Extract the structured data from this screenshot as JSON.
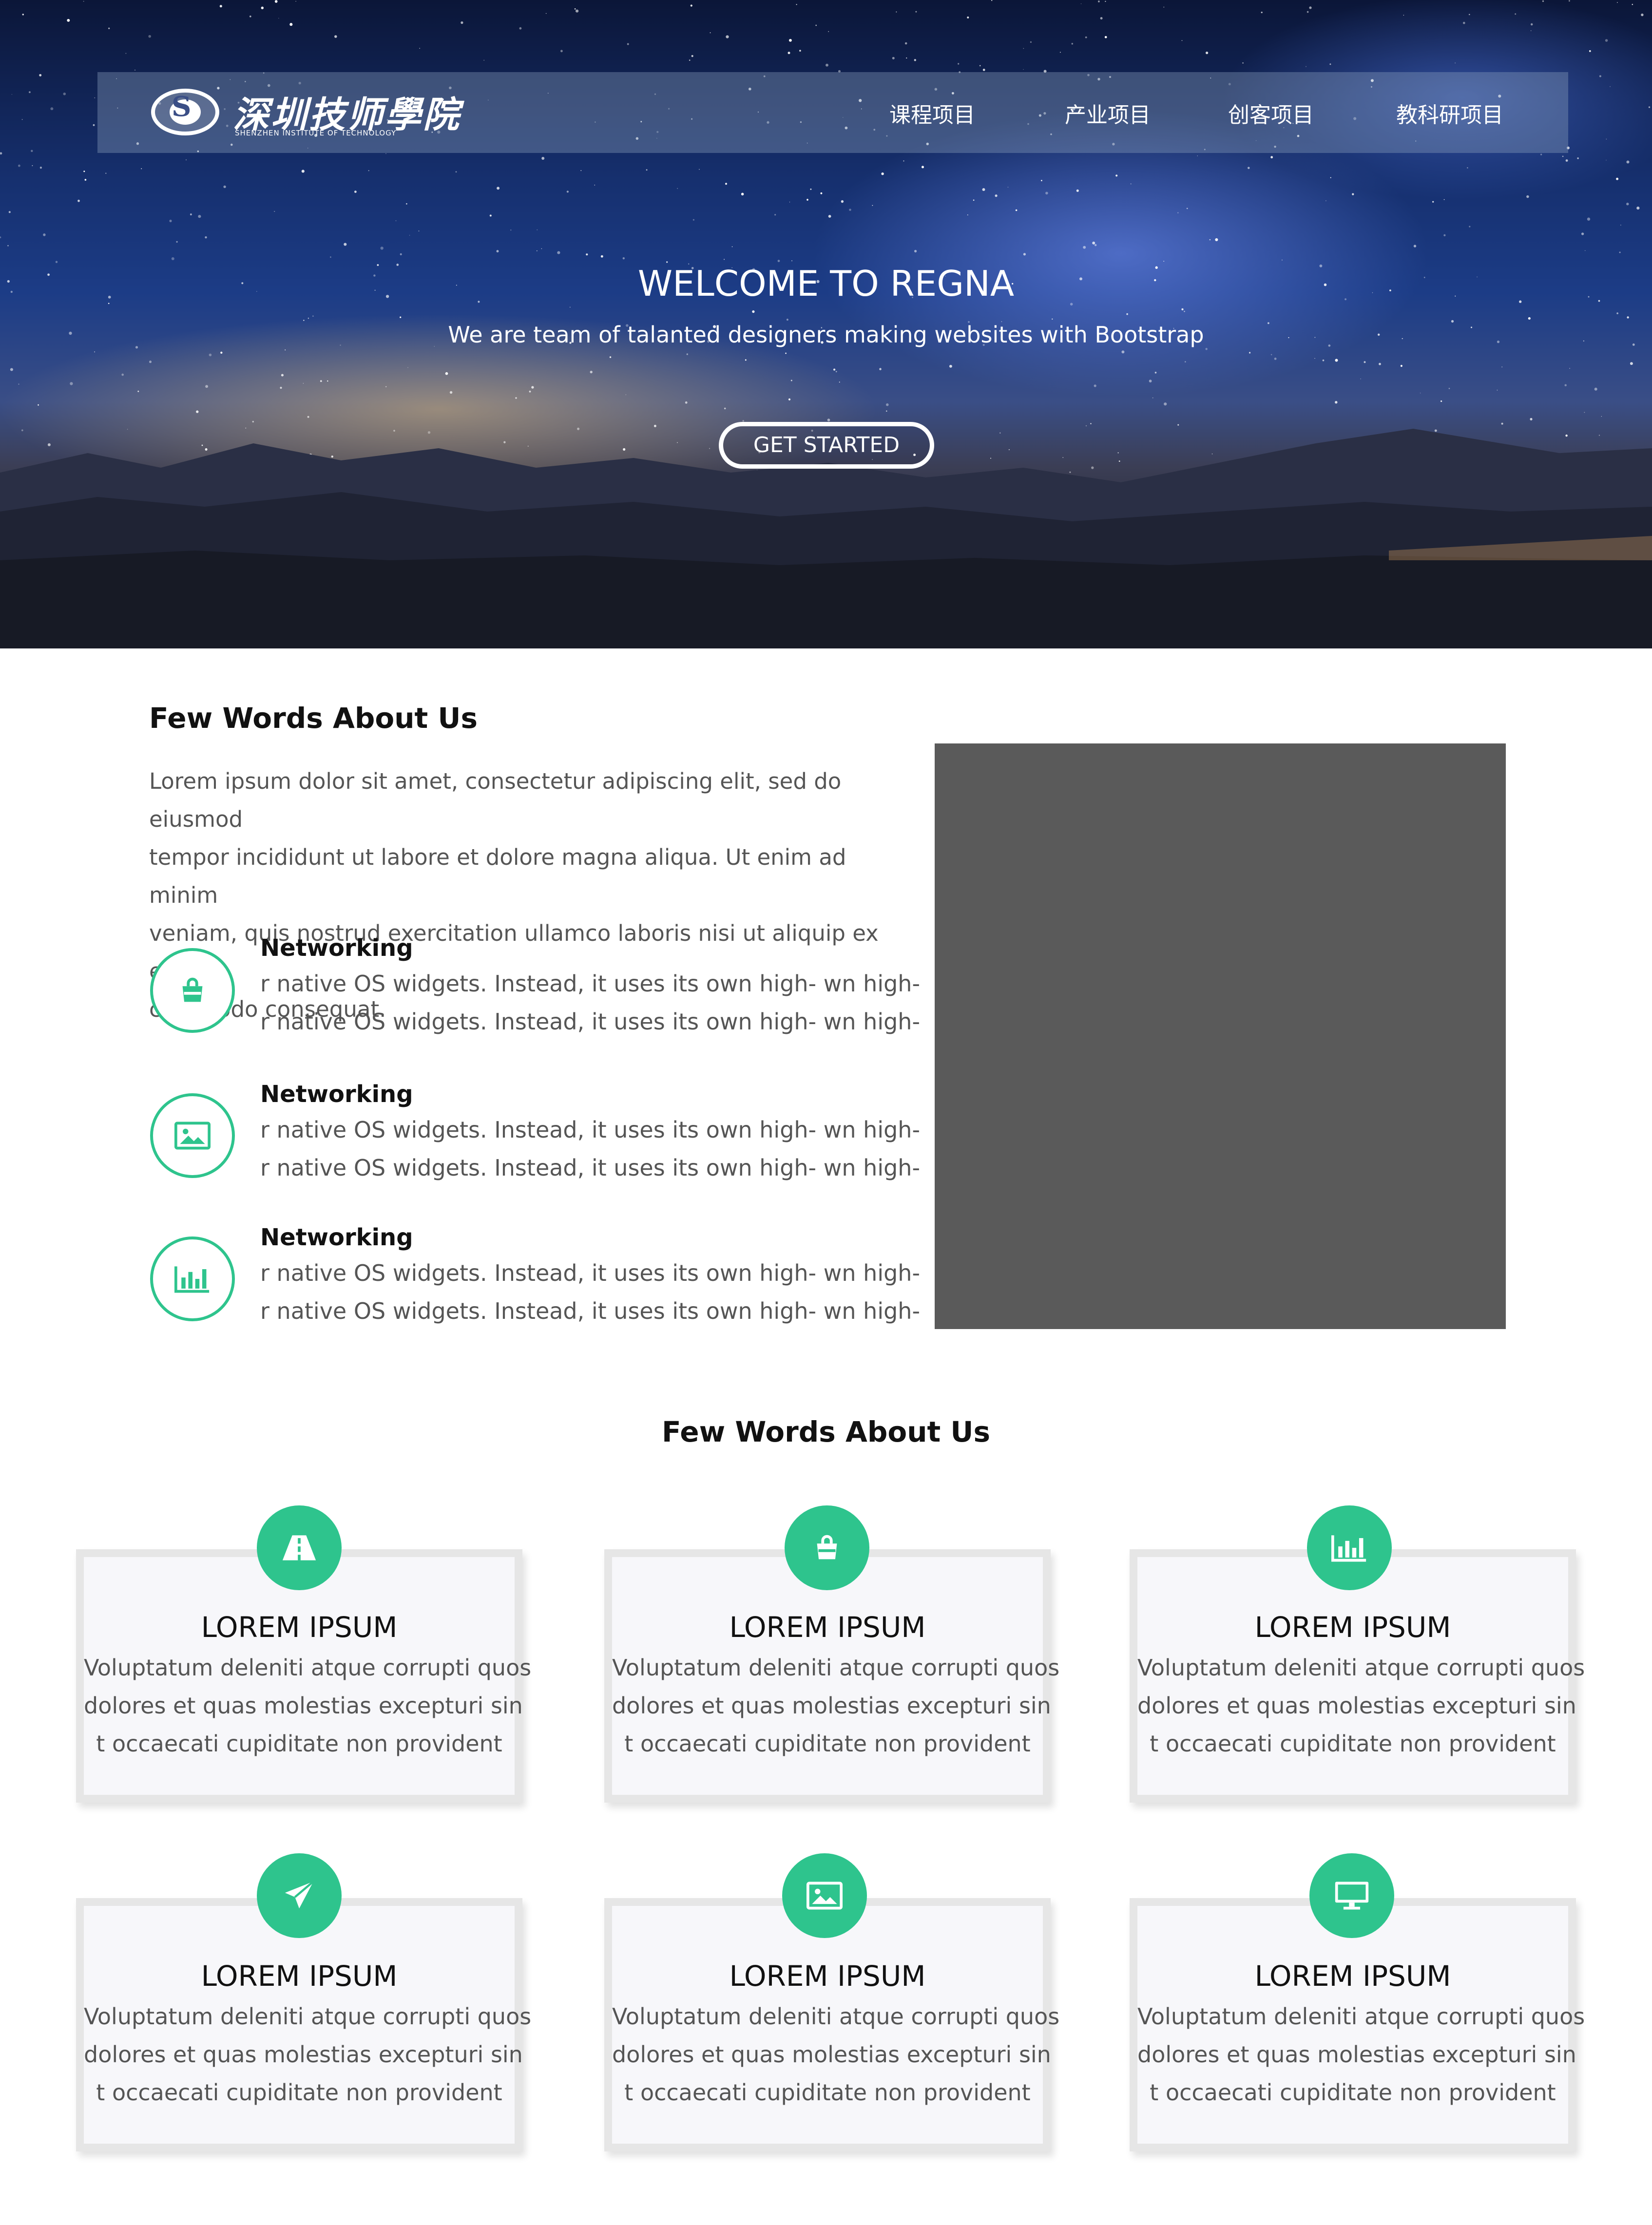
{
  "header": {
    "logo_cn": "深圳技师學院",
    "logo_en": "SHENZHEN INSTITUTE OF TECHNOLOGY",
    "nav": [
      {
        "label": "课程项目"
      },
      {
        "label": "产业项目"
      },
      {
        "label": "创客项目"
      },
      {
        "label": "教科研项目"
      }
    ]
  },
  "hero": {
    "title": "WELCOME TO REGNA",
    "subtitle": "We are team of talanted designers making websites with Bootstrap",
    "cta_label": "GET STARTED"
  },
  "about": {
    "title": "Few Words About Us",
    "paragraph_lines": [
      "Lorem ipsum dolor sit amet, consectetur adipiscing elit, sed do eiusmod",
      "tempor incididunt ut labore et dolore magna aliqua. Ut enim ad minim",
      "veniam, quis nostrud exercitation ullamco laboris nisi ut aliquip ex ea",
      "commodo consequat."
    ],
    "features": [
      {
        "icon": "shopping-bag-icon",
        "title": "Networking",
        "line1": "r native OS widgets. Instead, it uses its own high- wn high-",
        "line2": "r native OS widgets. Instead, it uses its own high- wn high-"
      },
      {
        "icon": "image-icon",
        "title": "Networking",
        "line1": "r native OS widgets. Instead, it uses its own high- wn high-",
        "line2": "r native OS widgets. Instead, it uses its own high- wn high-"
      },
      {
        "icon": "bar-chart-icon",
        "title": "Networking",
        "line1": "r native OS widgets. Instead, it uses its own high- wn high-",
        "line2": "r native OS widgets. Instead, it uses its own high- wn high-"
      }
    ]
  },
  "services": {
    "title": "Few Words About Us",
    "cards": [
      {
        "icon": "road-icon",
        "title": "LOREM IPSUM",
        "lines": [
          "Voluptatum deleniti atque corrupti quos",
          "dolores et quas molestias excepturi sin",
          "t occaecati cupiditate non provident"
        ]
      },
      {
        "icon": "shopping-bag-icon",
        "title": "LOREM IPSUM",
        "lines": [
          "Voluptatum deleniti atque corrupti quos",
          "dolores et quas molestias excepturi sin",
          "t occaecati cupiditate non provident"
        ]
      },
      {
        "icon": "bar-chart-icon",
        "title": "LOREM IPSUM",
        "lines": [
          "Voluptatum deleniti atque corrupti quos",
          "dolores et quas molestias excepturi sin",
          "t occaecati cupiditate non provident"
        ]
      },
      {
        "icon": "paper-plane-icon",
        "title": "LOREM IPSUM",
        "lines": [
          "Voluptatum deleniti atque corrupti quos",
          "dolores et quas molestias excepturi sin",
          "t occaecati cupiditate non provident"
        ]
      },
      {
        "icon": "image-icon",
        "title": "LOREM IPSUM",
        "lines": [
          "Voluptatum deleniti atque corrupti quos",
          "dolores et quas molestias excepturi sin",
          "t occaecati cupiditate non provident"
        ]
      },
      {
        "icon": "monitor-icon",
        "title": "LOREM IPSUM",
        "lines": [
          "Voluptatum deleniti atque corrupti quos",
          "dolores et quas molestias excepturi sin",
          "t occaecati cupiditate non provident"
        ]
      }
    ]
  },
  "colors": {
    "accent": "#2ec48d",
    "image_placeholder": "#5a5a5a"
  }
}
